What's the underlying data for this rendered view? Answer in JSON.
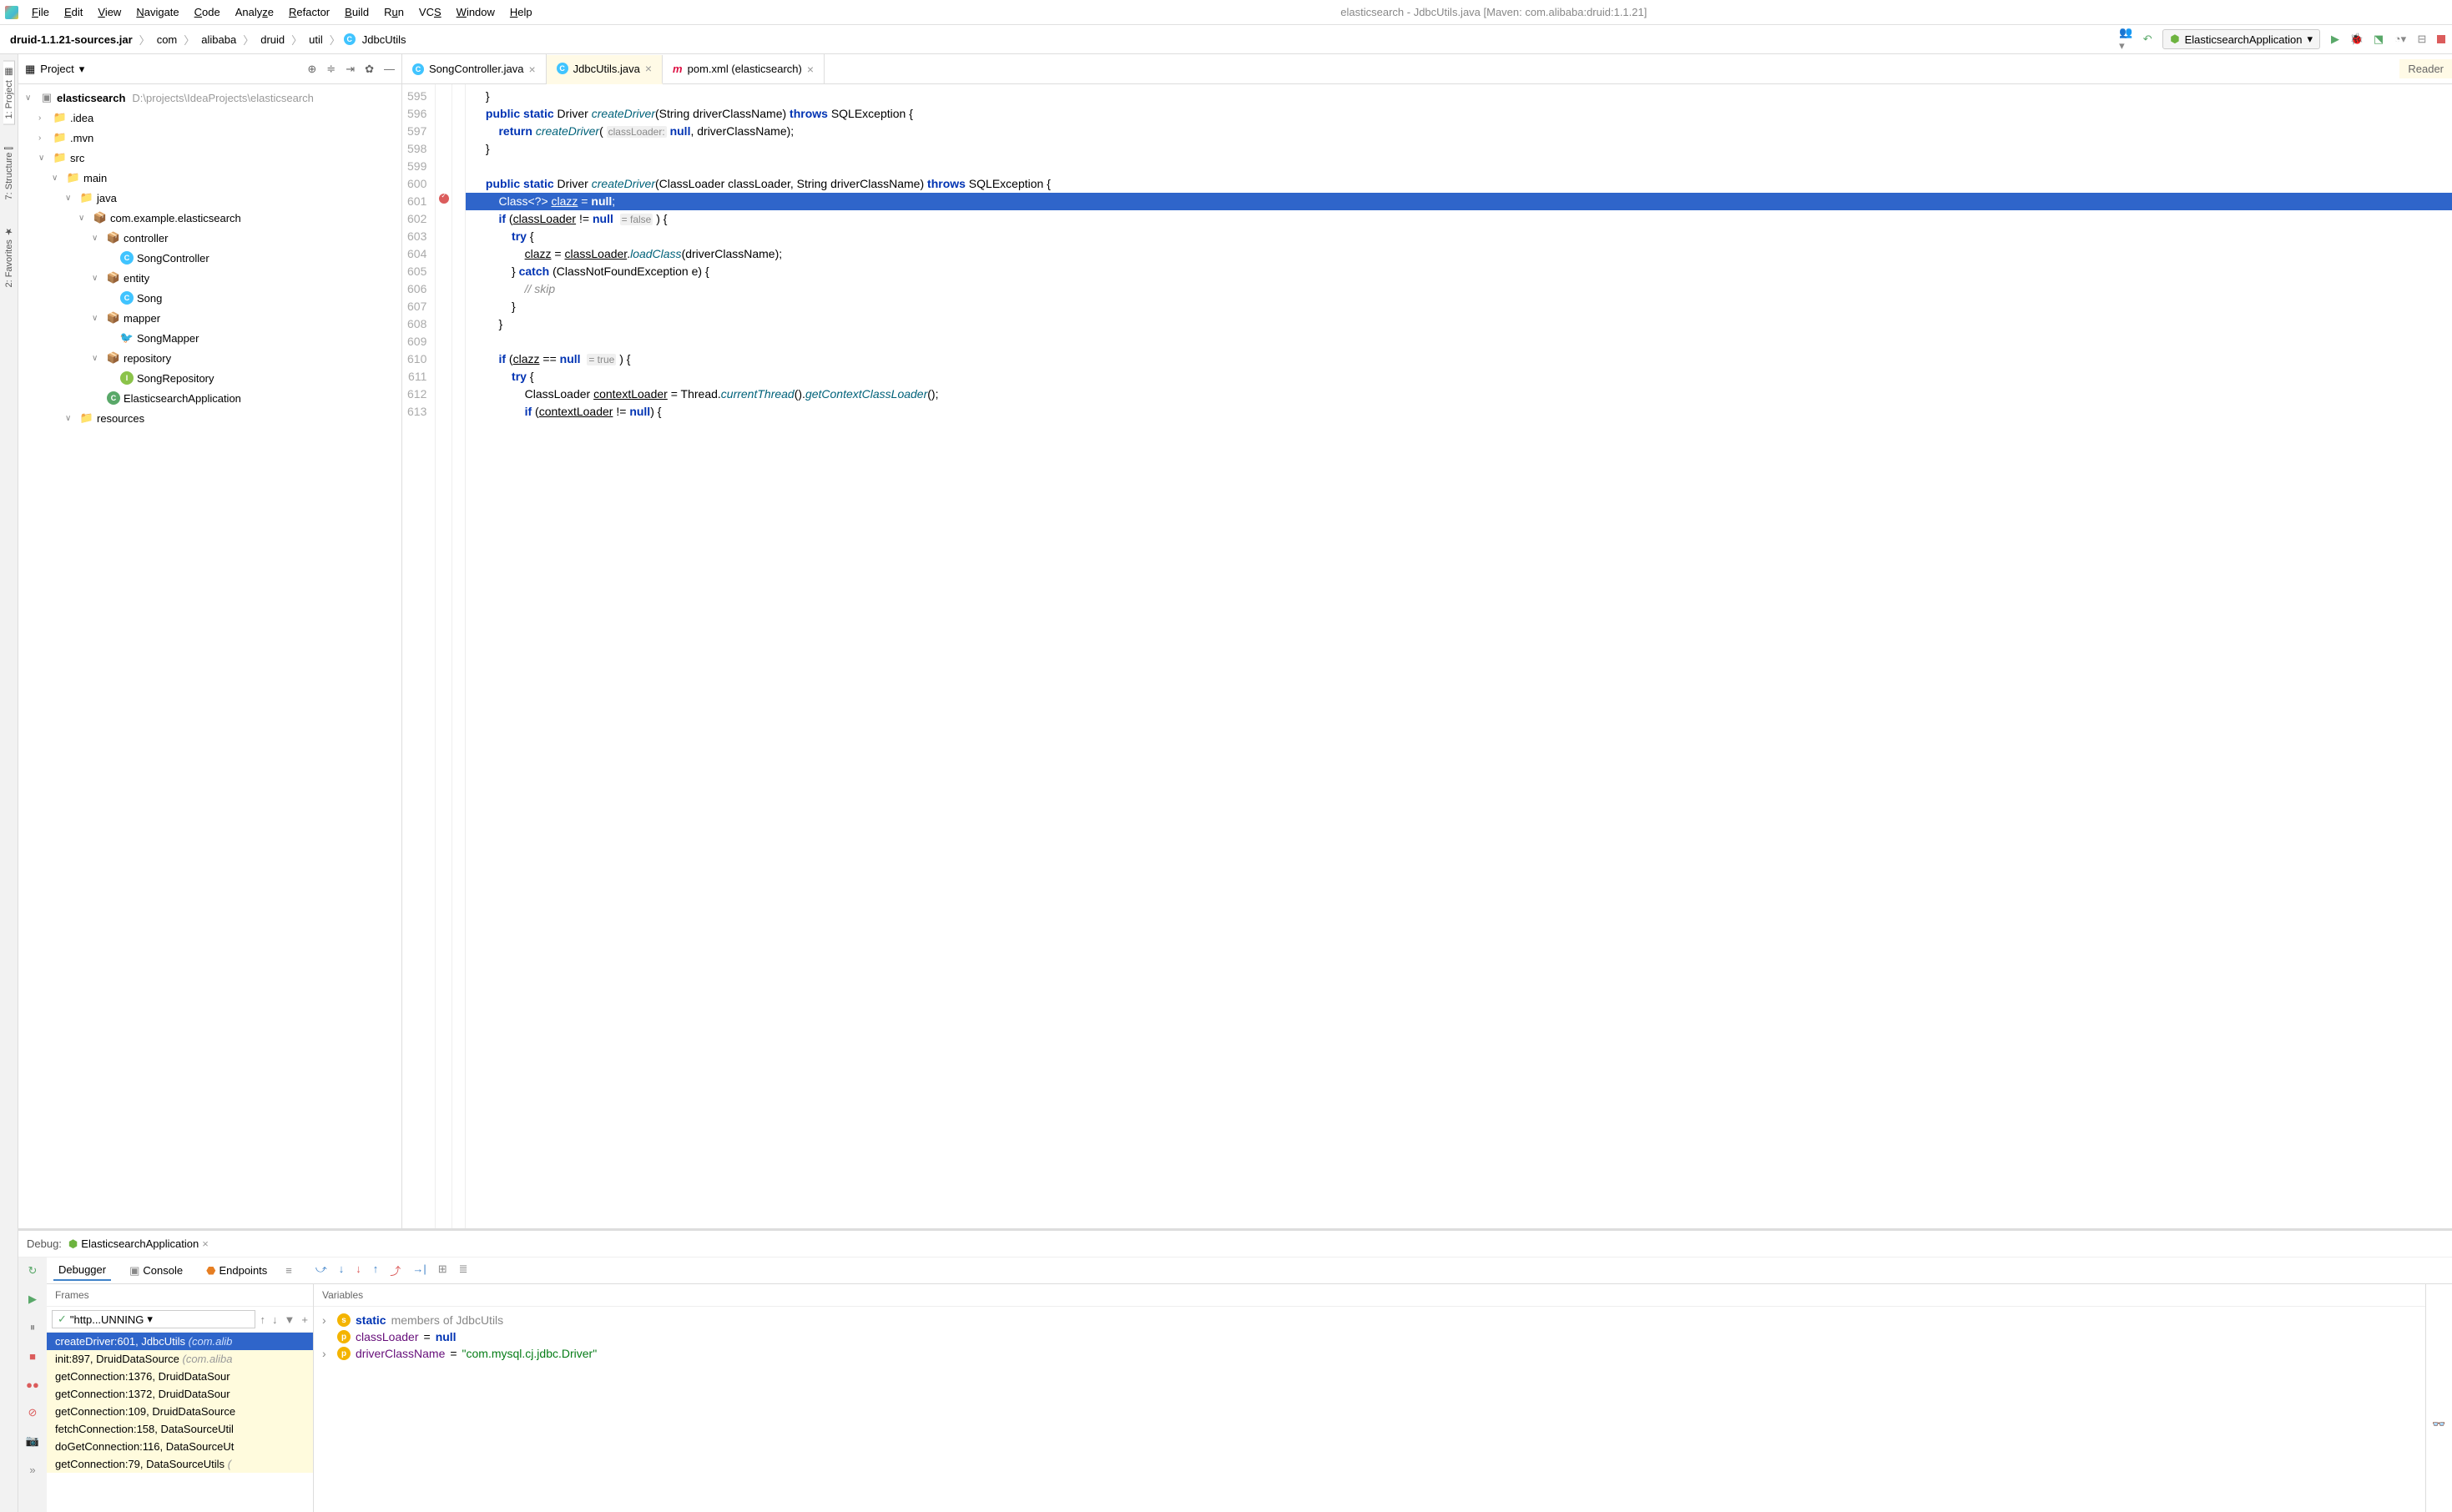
{
  "menus": [
    "File",
    "Edit",
    "View",
    "Navigate",
    "Code",
    "Analyze",
    "Refactor",
    "Build",
    "Run",
    "VCS",
    "Window",
    "Help"
  ],
  "windowTitle": "elasticsearch - JdbcUtils.java [Maven: com.alibaba:druid:1.1.21]",
  "breadcrumb": [
    "druid-1.1.21-sources.jar",
    "com",
    "alibaba",
    "druid",
    "util",
    "JdbcUtils"
  ],
  "runConfig": "ElasticsearchApplication",
  "projectPanel": {
    "title": "Project"
  },
  "tree": {
    "root": {
      "name": "elasticsearch",
      "path": "D:\\projects\\IdeaProjects\\elasticsearch"
    },
    "idea": ".idea",
    "mvn": ".mvn",
    "src": "src",
    "main": "main",
    "java": "java",
    "pkg": "com.example.elasticsearch",
    "controller": "controller",
    "songController": "SongController",
    "entity": "entity",
    "song": "Song",
    "mapper": "mapper",
    "songMapper": "SongMapper",
    "repository": "repository",
    "songRepository": "SongRepository",
    "app": "ElasticsearchApplication",
    "resources": "resources"
  },
  "tabs": [
    {
      "label": "SongController.java",
      "icon": "c"
    },
    {
      "label": "JdbcUtils.java",
      "icon": "c",
      "active": true
    },
    {
      "label": "pom.xml (elasticsearch)",
      "icon": "m"
    }
  ],
  "readerBadge": "Reader",
  "code": {
    "startLine": 595,
    "lines": [
      "    }",
      "    public static Driver createDriver(String driverClassName) throws SQLException {",
      "        return createDriver( classLoader: null, driverClassName);",
      "    }",
      "",
      "    public static Driver createDriver(ClassLoader classLoader, String driverClassName) throws SQLException {",
      "        Class<?> clazz = null;",
      "        if (classLoader != null  = false ) {",
      "            try {",
      "                clazz = classLoader.loadClass(driverClassName);",
      "            } catch (ClassNotFoundException e) {",
      "                // skip",
      "            }",
      "        }",
      "",
      "        if (clazz == null  = true ) {",
      "            try {",
      "                ClassLoader contextLoader = Thread.currentThread().getContextClassLoader();",
      "                if (contextLoader != null) {"
    ],
    "highlightIndex": 6
  },
  "debug": {
    "label": "Debug:",
    "config": "ElasticsearchApplication",
    "tabs": [
      "Debugger",
      "Console",
      "Endpoints"
    ],
    "framesLabel": "Frames",
    "varsLabel": "Variables",
    "thread": "\"http...UNNING",
    "frames": [
      {
        "text": "createDriver:601, JdbcUtils ",
        "pkg": "(com.alib",
        "selected": true
      },
      {
        "text": "init:897, DruidDataSource ",
        "pkg": "(com.aliba"
      },
      {
        "text": "getConnection:1376, DruidDataSour",
        "pkg": ""
      },
      {
        "text": "getConnection:1372, DruidDataSour",
        "pkg": ""
      },
      {
        "text": "getConnection:109, DruidDataSource",
        "pkg": ""
      },
      {
        "text": "fetchConnection:158, DataSourceUtil",
        "pkg": ""
      },
      {
        "text": "doGetConnection:116, DataSourceUt",
        "pkg": ""
      },
      {
        "text": "getConnection:79, DataSourceUtils ",
        "pkg": "("
      }
    ],
    "vars": [
      {
        "expand": true,
        "badge": "s",
        "name": "static",
        "rest": " members of JdbcUtils",
        "type": "static"
      },
      {
        "expand": false,
        "badge": "p",
        "name": "classLoader",
        "val": "null",
        "type": "null"
      },
      {
        "expand": true,
        "badge": "p",
        "name": "driverClassName",
        "val": "\"com.mysql.cj.jdbc.Driver\"",
        "type": "str"
      }
    ]
  },
  "leftGutter": [
    "Project",
    "Structure",
    "Favorites"
  ]
}
